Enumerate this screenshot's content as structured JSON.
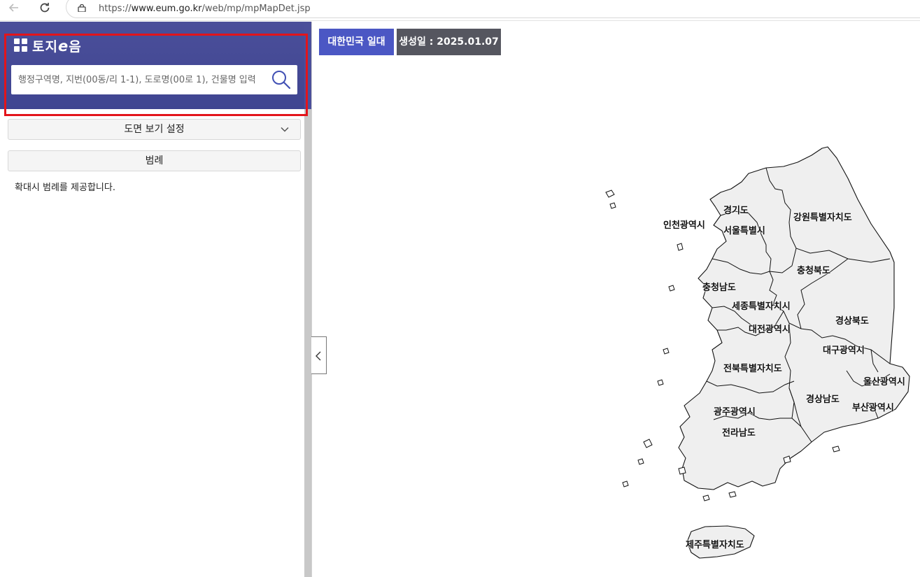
{
  "browser": {
    "url_prefix": "https://",
    "url_host": "www.eum.go.kr",
    "url_path": "/web/mp/mpMapDet.jsp"
  },
  "panel": {
    "logo_text_1": "토지",
    "logo_text_e": "e",
    "logo_text_2": "음",
    "search": {
      "placeholder": "행정구역명, 지번(00동/리 1-1), 도로명(00로 1), 건물명 입력",
      "value": ""
    },
    "view_settings_label": "도면 보기 설정",
    "legend_label": "범례",
    "legend_note": "확대시 범례를 제공합니다."
  },
  "map": {
    "region_badge": "대한민국 일대",
    "date_badge": "생성일 : 2025.01.07",
    "regions": [
      "경기도",
      "인천광역시",
      "서울특별시",
      "강원특별자치도",
      "충청북도",
      "충청남도",
      "세종특별자치시",
      "경상북도",
      "대전광역시",
      "대구광역시",
      "전북특별자치도",
      "울산광역시",
      "경상남도",
      "부산광역시",
      "광주광역시",
      "전라남도",
      "제주특별자치도"
    ]
  },
  "colors": {
    "header": "#4b4f9a",
    "badge_region": "#4b57c4",
    "badge_date": "#55565f",
    "highlight": "#e3141b"
  }
}
